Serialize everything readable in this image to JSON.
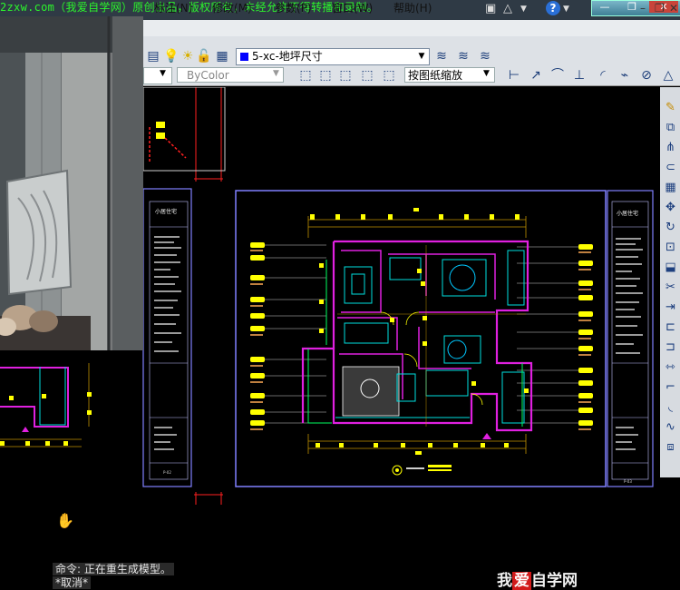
{
  "banner": {
    "watermark": "2zxw.com（我爱自学网）原创出品，版权所有，未经允许不得转播和录制。"
  },
  "menubar": {
    "items": [
      {
        "label": "标注(N)"
      },
      {
        "label": "修改(M)"
      },
      {
        "label": "参数(P)"
      },
      {
        "label": "窗口(W)"
      },
      {
        "label": "帮助(H)"
      }
    ]
  },
  "toolbar": {
    "layer_name": "5-xc-地坪尺寸",
    "color_value": "ByColor",
    "scale_value": "按图纸缩放"
  },
  "drawing": {
    "sheet_title_left": "小居住宅",
    "sheet_title_right": "小居住宅",
    "sheet_code_left": "P-02",
    "sheet_code_right": "P-03"
  },
  "command": {
    "line1": "命令: 正在重生成模型。",
    "line2": "*取消*"
  },
  "logo": {
    "text_a": "我",
    "text_b": "爱",
    "text_c": "自学网"
  },
  "colors": {
    "cad_background": "#000000",
    "wall_magenta": "#e020e0",
    "dim_yellow": "#ffff00",
    "frame_blue": "#8080ff",
    "red_marker": "#ff2020",
    "watermark_green": "#2cf52c"
  }
}
